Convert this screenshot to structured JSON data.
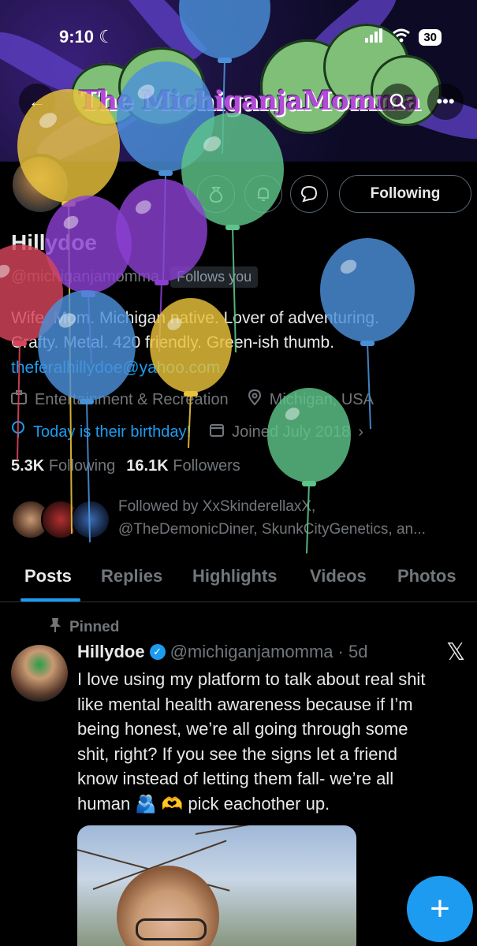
{
  "status_bar": {
    "time": "9:10",
    "battery": "30"
  },
  "banner": {
    "title": "The MichiganjaMomma"
  },
  "profile": {
    "name": "Hillydoe",
    "handle": "@michiganjamomma",
    "follows_you": "Follows you",
    "bio_line1": "Wife. Mom. Michigan native. Lover of adventuring.",
    "bio_line2": "Crafty. Metal. 420 friendly. Green-ish thumb.",
    "email": "theferalhillydoe@yahoo.com",
    "category": "Entertainment & Recreation",
    "location": "Michigan, USA",
    "birthday": "Today is their birthday!",
    "joined": "Joined July 2018",
    "following_count": "5.3K",
    "following_label": "Following",
    "followers_count": "16.1K",
    "followers_label": "Followers",
    "followed_by_line1": "Followed by XxSkinderellaxX,",
    "followed_by_line2": "@TheDemonicDiner, SkunkCityGenetics, an..."
  },
  "actions": {
    "following_button": "Following"
  },
  "tabs": [
    "Posts",
    "Replies",
    "Highlights",
    "Videos",
    "Photos"
  ],
  "post": {
    "pinned_label": "Pinned",
    "name": "Hillydoe",
    "handle": "@michiganjamomma",
    "time": "· 5d",
    "text_lines": [
      "I love using my platform to talk about real shit",
      "like mental health awareness because if I’m",
      "being honest, we’re all going through some",
      "shit, right? If you see the signs let a friend",
      "know instead of letting them fall- we’re all",
      "human 🫂 🫶 pick eachother up."
    ]
  },
  "colors": {
    "accent": "#1d9bf0",
    "balloon_yellow": "#e8c23a",
    "balloon_blue": "#4a90d9",
    "balloon_green": "#5ec48a",
    "balloon_purple": "#8a3fd1",
    "balloon_red": "#d6455a"
  },
  "icons": {
    "back": "back-arrow-icon",
    "search": "search-icon",
    "more": "more-icon",
    "money": "money-bag-icon",
    "notify": "bell-icon",
    "message": "message-icon",
    "category": "briefcase-icon",
    "location": "location-pin-icon",
    "birthday": "balloon-icon",
    "calendar": "calendar-icon",
    "pin": "pin-icon",
    "compose": "plus-icon"
  }
}
